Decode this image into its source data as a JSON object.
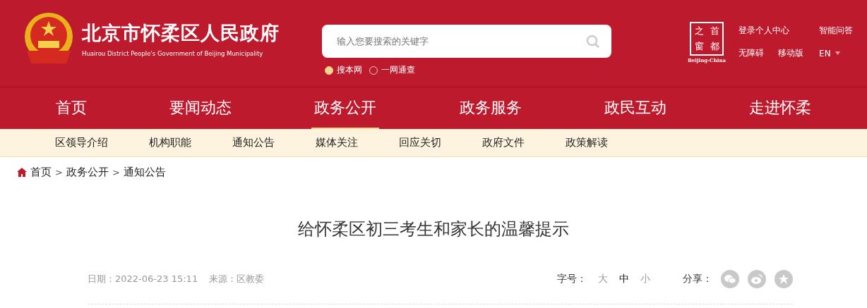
{
  "header": {
    "site_name": "北京市怀柔区人民政府",
    "site_name_en": "Huairou District People's Government of Beijing Municipality",
    "search": {
      "placeholder": "输入您要搜索的关键字",
      "scopes": [
        {
          "label": "搜本网",
          "selected": true
        },
        {
          "label": "一网通查",
          "selected": false
        }
      ]
    },
    "capital_logo": {
      "chars": [
        "之",
        "首",
        "窗",
        "都"
      ],
      "caption": "Beijing-China"
    },
    "links": [
      {
        "label": "登录个人中心"
      },
      {
        "label": "智能问答"
      },
      {
        "label": "无障碍"
      },
      {
        "label": "移动版"
      },
      {
        "label": "EN",
        "dropdown": true
      }
    ]
  },
  "nav": [
    {
      "label": "首页",
      "selected": false
    },
    {
      "label": "要闻动态",
      "selected": false
    },
    {
      "label": "政务公开",
      "selected": true
    },
    {
      "label": "政务服务",
      "selected": false
    },
    {
      "label": "政民互动",
      "selected": false
    },
    {
      "label": "走进怀柔",
      "selected": false
    }
  ],
  "subnav": [
    "区领导介绍",
    "机构职能",
    "通知公告",
    "媒体关注",
    "回应关切",
    "政府文件",
    "政策解读"
  ],
  "breadcrumb": {
    "items": [
      "首页",
      "政务公开",
      "通知公告"
    ],
    "separator": ">"
  },
  "article": {
    "title": "给怀柔区初三考生和家长的温馨提示",
    "date": "日期：2022-06-23 15:11",
    "source": "来源：区教委",
    "font_size_label": "字号：",
    "font_sizes": [
      {
        "label": "大",
        "selected": false
      },
      {
        "label": "中",
        "selected": true
      },
      {
        "label": "小",
        "selected": false
      }
    ],
    "share_label": "分享：",
    "share": [
      {
        "kind": "wechat"
      },
      {
        "kind": "weibo"
      },
      {
        "kind": "qzone"
      }
    ]
  }
}
